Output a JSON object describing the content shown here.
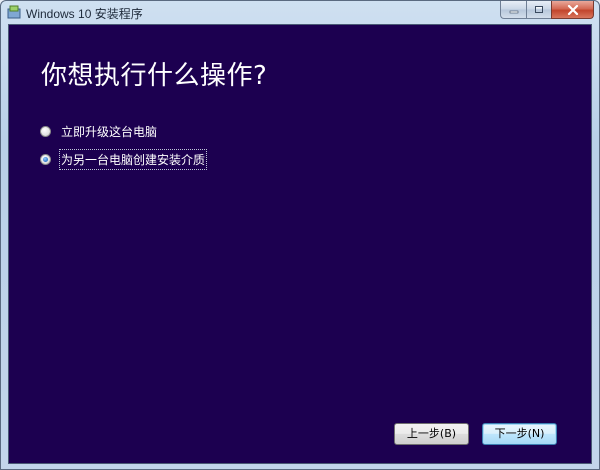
{
  "window": {
    "title": "Windows 10 安装程序",
    "controls": {
      "minimize_icon": "minimize-icon",
      "maximize_icon": "maximize-icon",
      "close_icon": "close-icon"
    }
  },
  "main": {
    "heading": "你想执行什么操作?",
    "background_color": "#1c0050",
    "options": [
      {
        "label": "立即升级这台电脑",
        "selected": false
      },
      {
        "label": "为另一台电脑创建安装介质",
        "selected": true
      }
    ]
  },
  "footer": {
    "back_label": "上一步(B)",
    "next_label": "下一步(N)"
  }
}
